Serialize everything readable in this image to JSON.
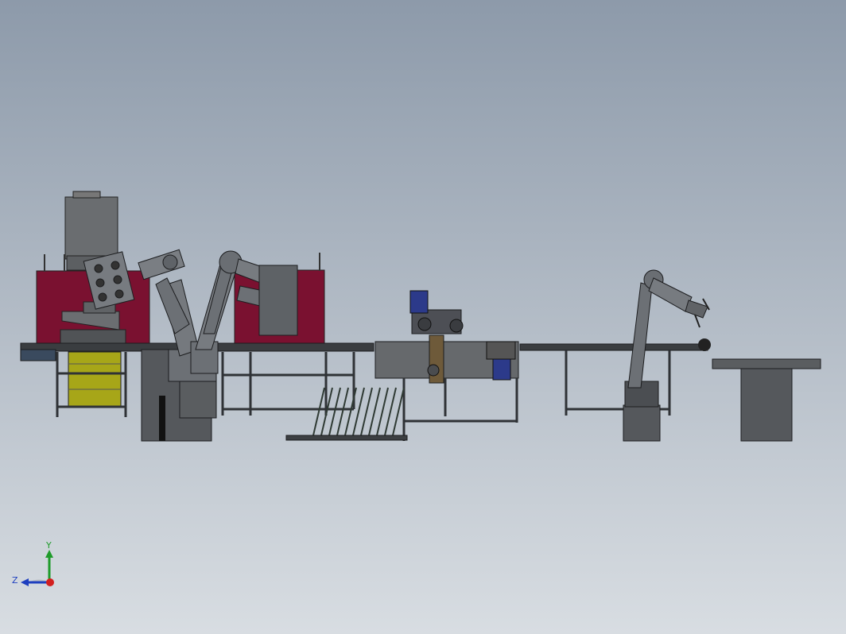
{
  "viewport": {
    "background_top": "#8d9aaa",
    "background_bottom": "#d8dde2"
  },
  "colors": {
    "machine_red": "#7a1130",
    "machine_yellow": "#a7a618",
    "frame_dark": "#2f3236",
    "body_gray": "#55585c",
    "robot_gray": "#6c7075",
    "motor_blue": "#2c3a8a",
    "axis_x": "#d21f1f",
    "axis_y": "#1e9b2a",
    "axis_z": "#1e3fbf"
  },
  "triad": {
    "y_label": "Y",
    "z_label": "Z"
  }
}
